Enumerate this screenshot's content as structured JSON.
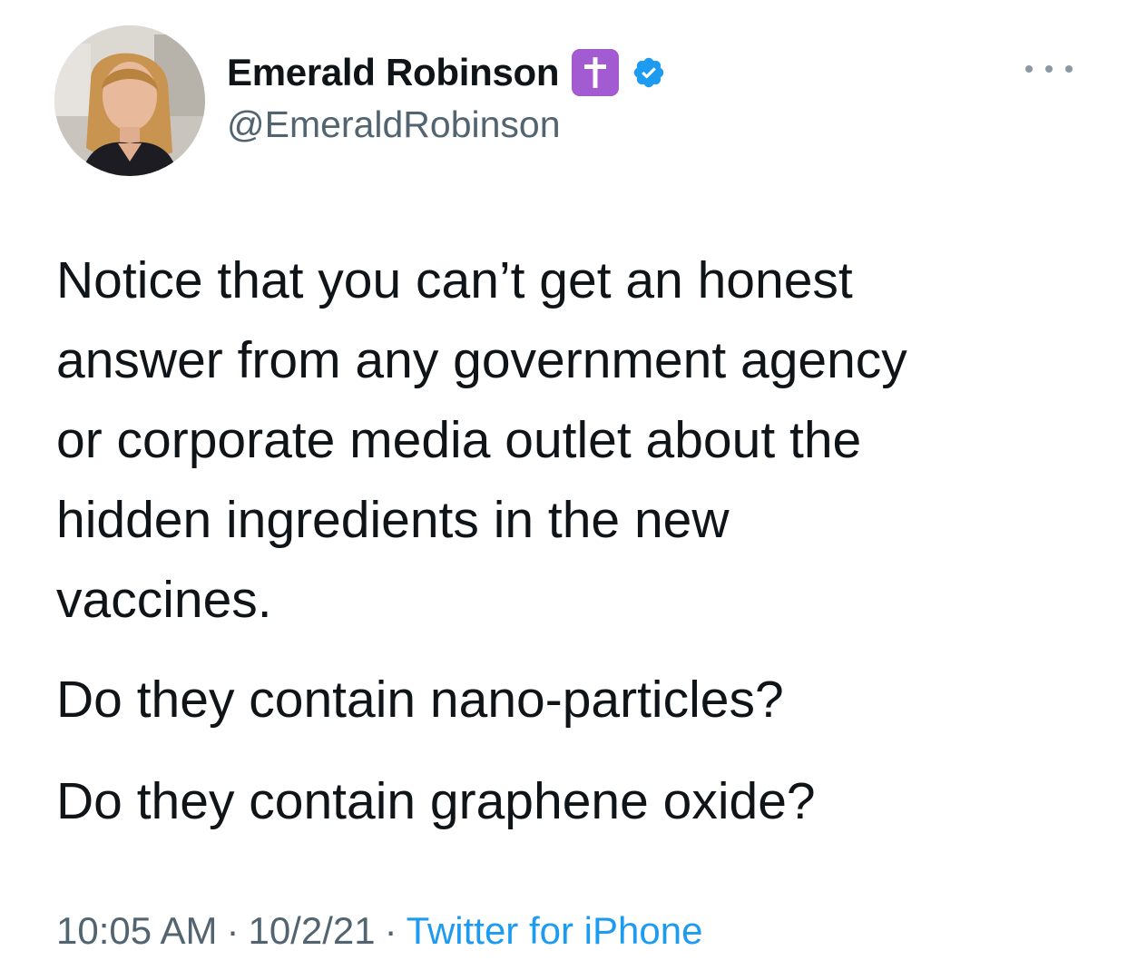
{
  "tweet": {
    "author": {
      "display_name": "Emerald Robinson",
      "handle": "@EmeraldRobinson",
      "badge_emoji": "latin-cross-emoji",
      "verified": true
    },
    "text_lines": [
      "Notice that you can’t get an honest",
      "answer from any government agency",
      "or corporate media outlet about the",
      "hidden ingredients in the new",
      "vaccines."
    ],
    "paragraph_2": "Do they contain nano-particles?",
    "paragraph_3": "Do they contain graphene oxide?",
    "meta": {
      "time": "10:05 AM",
      "separator": "·",
      "date": "10/2/21",
      "source": "Twitter for iPhone"
    }
  },
  "colors": {
    "text": "#0f1419",
    "secondary": "#536471",
    "accent": "#1d9bf0",
    "emoji_bg": "#a35bd1"
  }
}
